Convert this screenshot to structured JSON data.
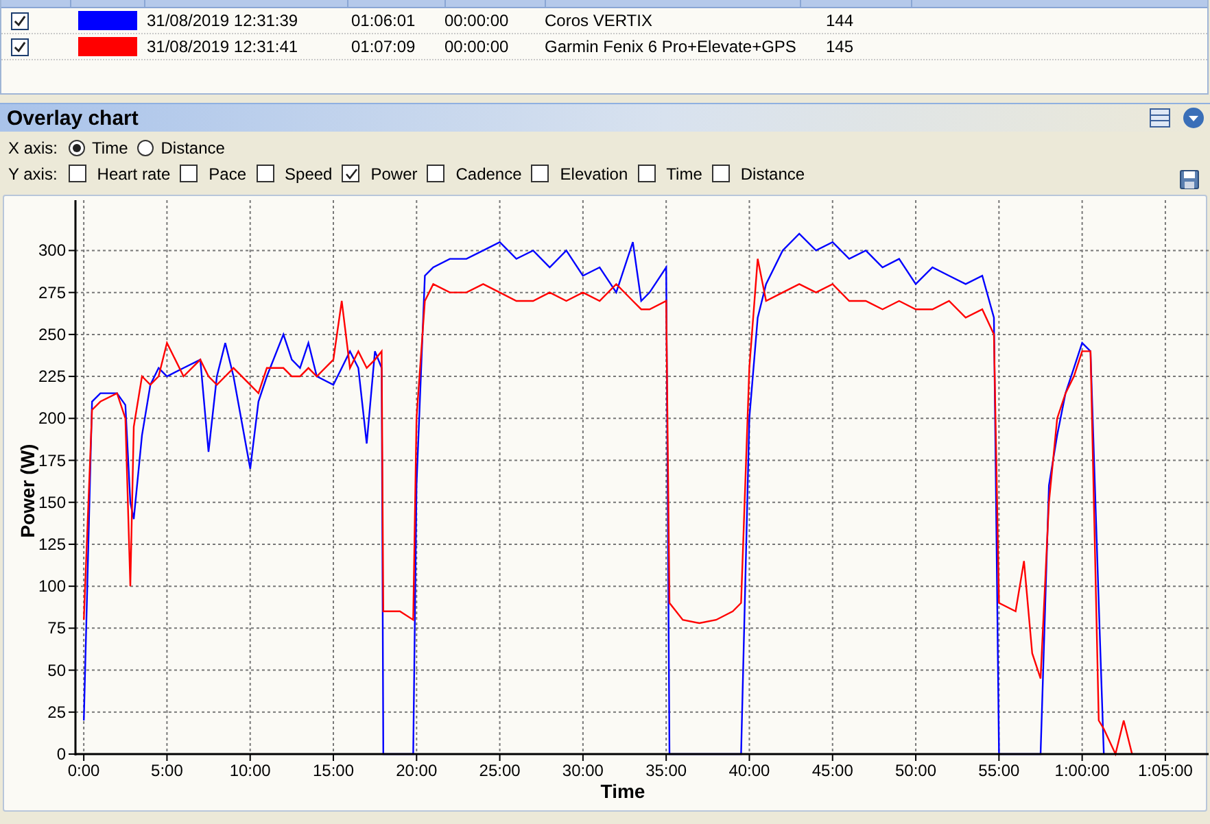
{
  "activities": {
    "rows": [
      {
        "checked": true,
        "color": "#0000ff",
        "column_3": "31/08/2019 12:31:39",
        "column_4": "01:06:01",
        "column_5": "00:00:00",
        "column_6": "Coros VERTIX",
        "column_7": "144"
      },
      {
        "checked": true,
        "color": "#ff0000",
        "column_3": "31/08/2019 12:31:41",
        "column_4": "01:07:09",
        "column_5": "00:00:00",
        "column_6": "Garmin Fenix 6 Pro+Elevate+GPS",
        "column_7": "145"
      }
    ]
  },
  "panel": {
    "title": "Overlay chart",
    "x_axis": {
      "label": "X axis:",
      "options": [
        {
          "label": "Time",
          "selected": true
        },
        {
          "label": "Distance",
          "selected": false
        }
      ]
    },
    "y_axis": {
      "label": "Y axis:",
      "options": [
        {
          "label": "Heart rate",
          "checked": false
        },
        {
          "label": "Pace",
          "checked": false
        },
        {
          "label": "Speed",
          "checked": false
        },
        {
          "label": "Power",
          "checked": true
        },
        {
          "label": "Cadence",
          "checked": false
        },
        {
          "label": "Elevation",
          "checked": false
        },
        {
          "label": "Time",
          "checked": false
        },
        {
          "label": "Distance",
          "checked": false
        }
      ]
    },
    "chart_data": {
      "type": "line",
      "grid": true,
      "xlabel": "Time",
      "ylabel": "Power (W)",
      "x": [
        0,
        0.5,
        1,
        2,
        2.5,
        2.8,
        3,
        3.5,
        4,
        4.5,
        5,
        6,
        7,
        7.5,
        8,
        8.5,
        9,
        10,
        10.5,
        11,
        12,
        12.5,
        13,
        13.5,
        14,
        15,
        15.5,
        16,
        16.5,
        17,
        17.5,
        17.9,
        18,
        19,
        19.8,
        20,
        20.5,
        21,
        22,
        23,
        24,
        25,
        26,
        27,
        28,
        29,
        30,
        31,
        32,
        33,
        33.5,
        34,
        35,
        35.2,
        36,
        37,
        38,
        39,
        39.5,
        40,
        40.5,
        41,
        42,
        43,
        44,
        45,
        46,
        47,
        48,
        49,
        50,
        51,
        52,
        53,
        54,
        54.7,
        55,
        56,
        56.5,
        57,
        57.5,
        58,
        58.5,
        59,
        59.5,
        60,
        60.5,
        61,
        61.3,
        62,
        62.5,
        63
      ],
      "series": [
        {
          "color": "#0000ff",
          "values": [
            20,
            210,
            215,
            215,
            208,
            150,
            140,
            190,
            220,
            230,
            225,
            230,
            235,
            180,
            225,
            245,
            225,
            170,
            210,
            225,
            250,
            235,
            230,
            245,
            225,
            220,
            230,
            240,
            230,
            185,
            240,
            230,
            0,
            0,
            0,
            160,
            285,
            290,
            295,
            295,
            300,
            305,
            295,
            300,
            290,
            300,
            285,
            290,
            275,
            305,
            270,
            275,
            290,
            0,
            0,
            0,
            0,
            0,
            0,
            200,
            260,
            280,
            300,
            310,
            300,
            305,
            295,
            300,
            290,
            295,
            280,
            290,
            285,
            280,
            285,
            260,
            0,
            0,
            0,
            0,
            0,
            160,
            190,
            215,
            230,
            245,
            240,
            90,
            0,
            null,
            null,
            null
          ]
        },
        {
          "color": "#ff0000",
          "values": [
            80,
            205,
            210,
            215,
            200,
            100,
            195,
            225,
            220,
            225,
            245,
            225,
            235,
            225,
            220,
            225,
            230,
            220,
            215,
            230,
            230,
            225,
            225,
            230,
            225,
            235,
            270,
            230,
            240,
            230,
            235,
            240,
            85,
            85,
            80,
            200,
            270,
            280,
            275,
            275,
            280,
            275,
            270,
            270,
            275,
            270,
            275,
            270,
            280,
            270,
            265,
            265,
            270,
            90,
            80,
            78,
            80,
            85,
            90,
            230,
            295,
            270,
            275,
            280,
            275,
            280,
            270,
            270,
            265,
            270,
            265,
            265,
            270,
            260,
            265,
            250,
            90,
            85,
            115,
            60,
            45,
            150,
            200,
            215,
            225,
            240,
            240,
            20,
            15,
            0,
            20,
            0
          ]
        }
      ],
      "xlim": [
        -0.5,
        67.6
      ],
      "ylim": [
        0,
        330
      ],
      "xticks": [
        {
          "value": 0,
          "label": "0:00"
        },
        {
          "value": 5,
          "label": "5:00"
        },
        {
          "value": 10,
          "label": "10:00"
        },
        {
          "value": 15,
          "label": "15:00"
        },
        {
          "value": 20,
          "label": "20:00"
        },
        {
          "value": 25,
          "label": "25:00"
        },
        {
          "value": 30,
          "label": "30:00"
        },
        {
          "value": 35,
          "label": "35:00"
        },
        {
          "value": 40,
          "label": "40:00"
        },
        {
          "value": 45,
          "label": "45:00"
        },
        {
          "value": 50,
          "label": "50:00"
        },
        {
          "value": 55,
          "label": "55:00"
        },
        {
          "value": 60,
          "label": "1:00:00"
        },
        {
          "value": 65,
          "label": "1:05:00"
        }
      ],
      "yticks": [
        0,
        25,
        50,
        75,
        100,
        125,
        150,
        175,
        200,
        225,
        250,
        275,
        300
      ]
    }
  }
}
